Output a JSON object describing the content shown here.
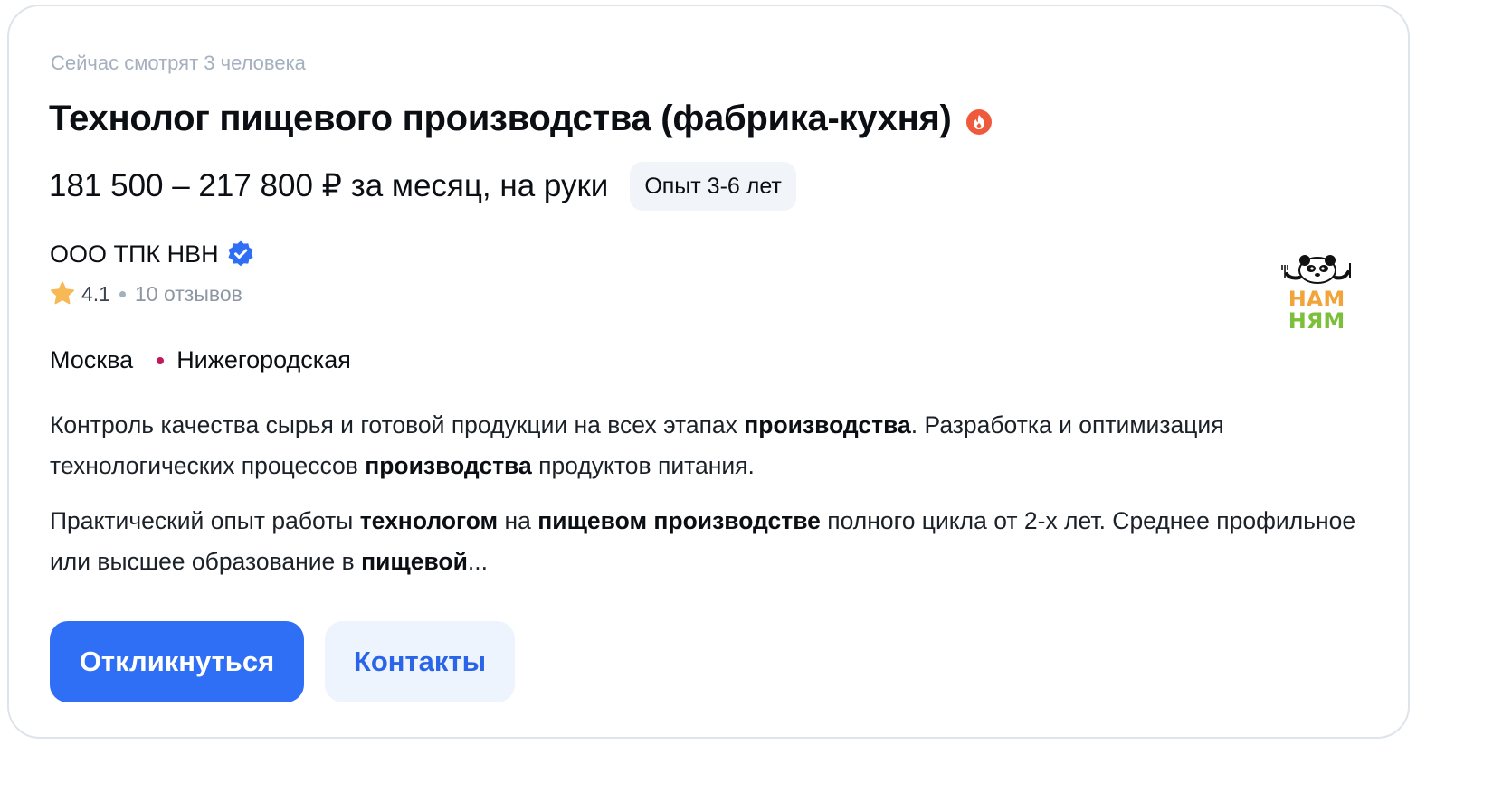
{
  "vacancy": {
    "viewers_text": "Сейчас смотрят 3 человека",
    "title": "Технолог пищевого производства (фабрика-кухня)",
    "hot_icon": "fire-icon",
    "salary": "181 500 – 217 800 ₽ за месяц, на руки",
    "experience_badge": "Опыт 3-6 лет"
  },
  "company": {
    "name": "ООО ТПК НВН",
    "verified_icon": "verified-check-icon",
    "rating": "4.1",
    "reviews": "10 отзывов",
    "logo": {
      "icon": "panda-logo",
      "line1": "НАМ",
      "line2": "НЯМ"
    }
  },
  "location": {
    "city": "Москва",
    "metro": "Нижегородская",
    "metro_color": "#c2185b"
  },
  "description": {
    "p1": [
      {
        "text": "Контроль качества сырья и готовой продукции на всех этапах ",
        "bold": false
      },
      {
        "text": "производства",
        "bold": true
      },
      {
        "text": ". Разработка и оптимизация технологических процессов ",
        "bold": false
      },
      {
        "text": "производства",
        "bold": true
      },
      {
        "text": " продуктов питания.",
        "bold": false
      }
    ],
    "p2": [
      {
        "text": "Практический опыт работы ",
        "bold": false
      },
      {
        "text": "технологом",
        "bold": true
      },
      {
        "text": " на ",
        "bold": false
      },
      {
        "text": "пищевом производстве",
        "bold": true
      },
      {
        "text": " полного цикла от 2-х лет. Среднее профильное или высшее образование в ",
        "bold": false
      },
      {
        "text": "пищевой",
        "bold": true
      },
      {
        "text": "...",
        "bold": false
      }
    ]
  },
  "actions": {
    "apply_label": "Откликнуться",
    "contacts_label": "Контакты"
  },
  "colors": {
    "accent": "#2f6ff6",
    "accent_light": "#eef4fd",
    "hot": "#f05a3c",
    "verified": "#2f6ff6",
    "star": "#f7b955"
  }
}
